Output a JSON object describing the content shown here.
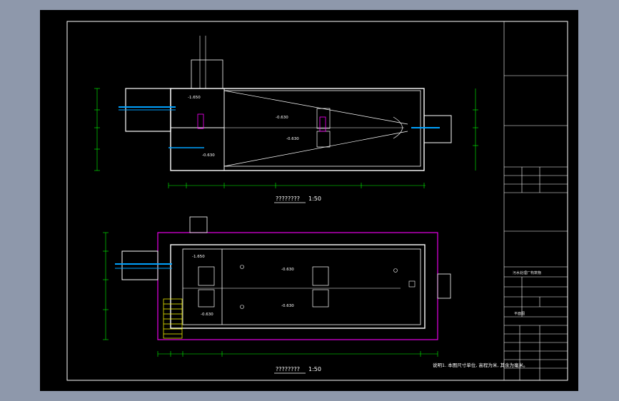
{
  "drawing": {
    "plan_top": {
      "title": "????????",
      "scale": "1:50"
    },
    "plan_bottom": {
      "title": "????????",
      "scale": "1:50"
    },
    "levels": {
      "top_small_room": "-1.650",
      "top_basin_upper": "-0.630",
      "top_basin_lower": "-0.630",
      "top_left_lower": "-0.630",
      "bottom_left": "-1.650",
      "bottom_upper": "-0.630",
      "bottom_lower": "-0.630",
      "bottom_left_lower": "-0.630"
    },
    "note": "说明1. 本图尺寸单位, 高程为米, 其余为毫米。"
  },
  "title_block": {
    "name_label": "平面图",
    "project_label": "污水处理厂构筑物"
  },
  "colors": {
    "background": "#8e98ab",
    "viewport": "#000000",
    "frame": "#ffffff",
    "wall": "#ffffff",
    "dimension": "#00ff00",
    "pipe": "#00a2ff",
    "outline": "#ff00ff",
    "label": "#ffff00"
  }
}
